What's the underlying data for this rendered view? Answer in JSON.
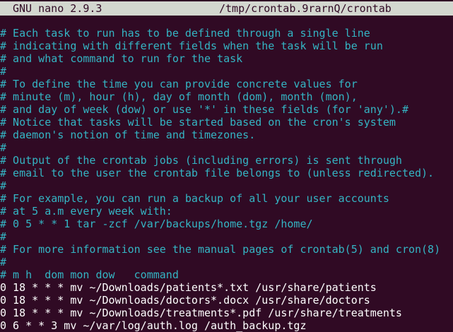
{
  "titlebar": {
    "app_version": "GNU nano 2.9.3",
    "file_path": "/tmp/crontab.9rarnQ/crontab"
  },
  "lines": [
    {
      "text": "# Each task to run has to be defined through a single line",
      "style": "comment"
    },
    {
      "text": "# indicating with different fields when the task will be run",
      "style": "comment"
    },
    {
      "text": "# and what command to run for the task",
      "style": "comment"
    },
    {
      "text": "#",
      "style": "comment"
    },
    {
      "text": "# To define the time you can provide concrete values for",
      "style": "comment"
    },
    {
      "text": "# minute (m), hour (h), day of month (dom), month (mon),",
      "style": "comment"
    },
    {
      "text": "# and day of week (dow) or use '*' in these fields (for 'any').#",
      "style": "comment"
    },
    {
      "text": "# Notice that tasks will be started based on the cron's system",
      "style": "comment"
    },
    {
      "text": "# daemon's notion of time and timezones.",
      "style": "comment"
    },
    {
      "text": "#",
      "style": "comment"
    },
    {
      "text": "# Output of the crontab jobs (including errors) is sent through",
      "style": "comment"
    },
    {
      "text": "# email to the user the crontab file belongs to (unless redirected).",
      "style": "comment"
    },
    {
      "text": "#",
      "style": "comment"
    },
    {
      "text": "# For example, you can run a backup of all your user accounts",
      "style": "comment"
    },
    {
      "text": "# at 5 a.m every week with:",
      "style": "comment"
    },
    {
      "text": "# 0 5 * * 1 tar -zcf /var/backups/home.tgz /home/",
      "style": "comment"
    },
    {
      "text": "#",
      "style": "comment"
    },
    {
      "text": "# For more information see the manual pages of crontab(5) and cron(8)",
      "style": "comment"
    },
    {
      "text": "#",
      "style": "comment"
    },
    {
      "text": "# m h  dom mon dow   command",
      "style": "comment"
    },
    {
      "text": "0 18 * * * mv ~/Downloads/patients*.txt /usr/share/patients",
      "style": "plain"
    },
    {
      "text": "0 18 * * * mv ~/Downloads/doctors*.docx /usr/share/doctors",
      "style": "plain"
    },
    {
      "text": "0 18 * * * mv ~/Downloads/treatments*.pdf /usr/share/treatments",
      "style": "plain"
    },
    {
      "text": "0 6 * * 3 mv ~/var/log/auth.log /auth_backup.tgz",
      "style": "plain"
    }
  ],
  "colors": {
    "background": "#300a24",
    "titlebar_background": "#d3d7cf",
    "titlebar_text": "#300a24",
    "comment": "#34b5c4",
    "plain": "#ffffff"
  }
}
